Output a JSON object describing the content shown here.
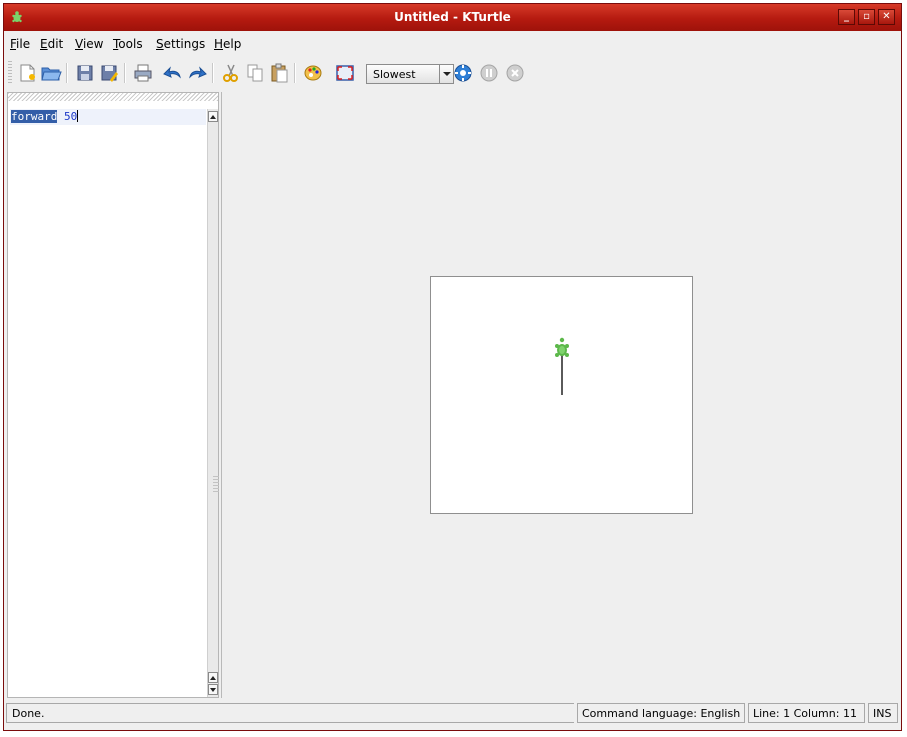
{
  "window": {
    "title": "Untitled - KTurtle"
  },
  "menu": [
    {
      "label": "File",
      "mnemonic": "F",
      "rest": "ile"
    },
    {
      "label": "Edit",
      "mnemonic": "E",
      "rest": "dit"
    },
    {
      "label": "View",
      "mnemonic": "V",
      "rest": "iew"
    },
    {
      "label": "Tools",
      "mnemonic": "T",
      "rest": "ools"
    },
    {
      "label": "Settings",
      "mnemonic": "S",
      "rest": "ettings"
    },
    {
      "label": "Help",
      "mnemonic": "H",
      "rest": "elp"
    }
  ],
  "toolbar": {
    "speed_value": "Slowest",
    "icons": [
      "new-file-icon",
      "open-folder-icon",
      "save-icon",
      "save-as-icon",
      "print-icon",
      "undo-icon",
      "redo-icon",
      "cut-icon",
      "copy-icon",
      "paste-icon",
      "color-picker-icon",
      "fullscreen-icon",
      "run-icon",
      "pause-icon",
      "abort-icon"
    ]
  },
  "editor": {
    "keyword": "forward",
    "argument": "50"
  },
  "status": {
    "message": "Done.",
    "language": "Command language: English",
    "position": "Line: 1 Column: 11",
    "mode": "INS"
  },
  "colors": {
    "titlebar": "#b51a10",
    "turtle": "#5cb84a",
    "selection": "#335ea8",
    "number": "#1b37c8"
  }
}
